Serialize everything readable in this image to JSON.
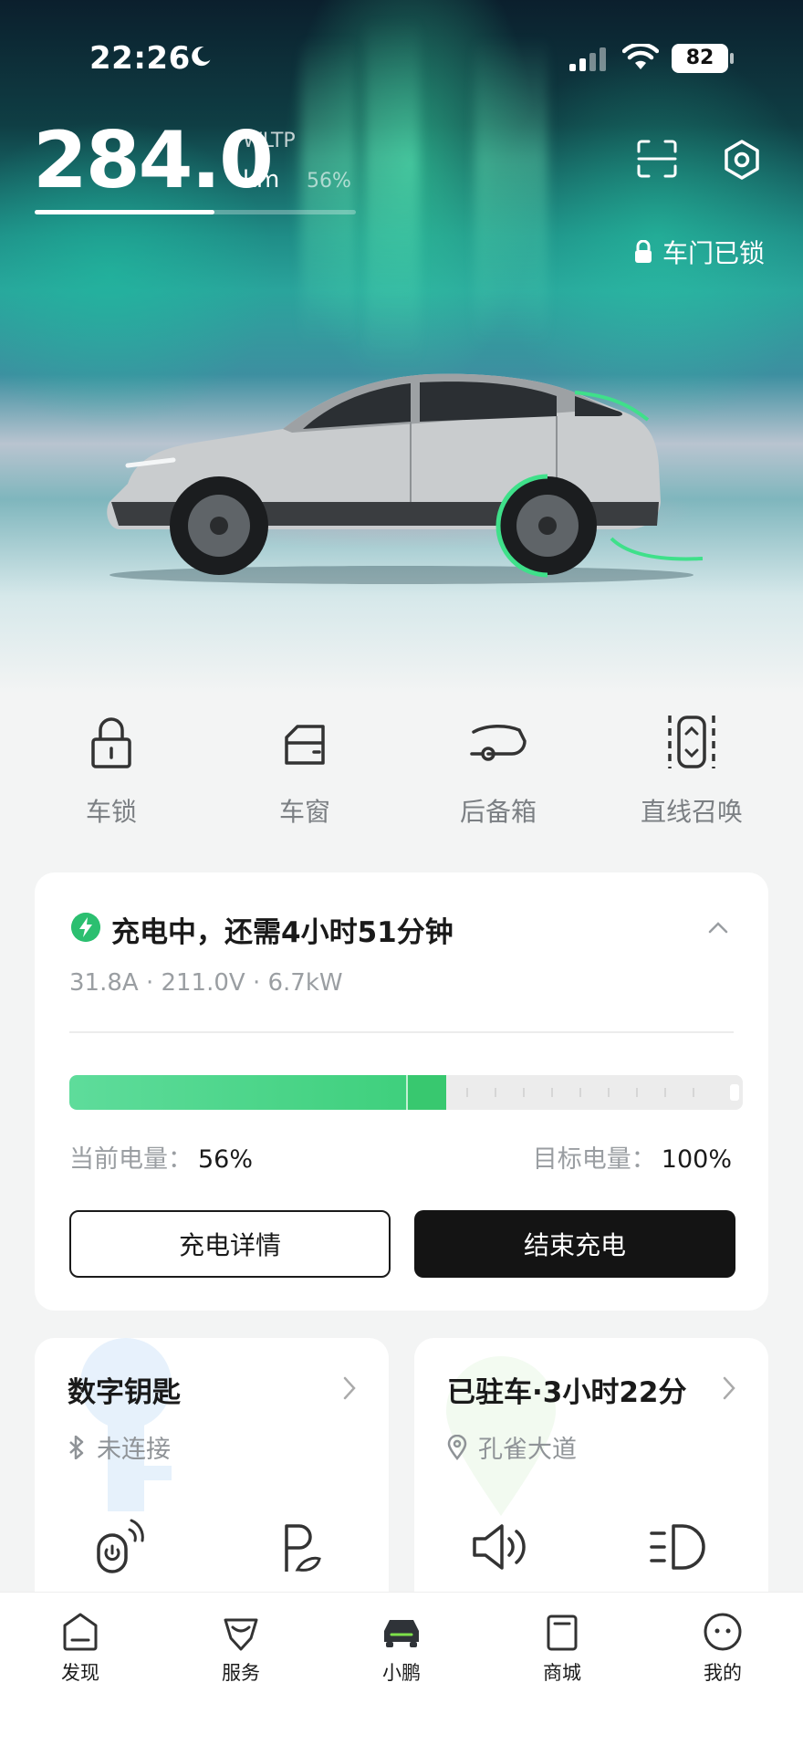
{
  "status_bar": {
    "time": "22:26",
    "battery": "82"
  },
  "vehicle": {
    "range_value": "284.0",
    "range_standard": "WLTP",
    "range_unit": "km",
    "battery_percent_text": "56%",
    "battery_fraction": 0.56,
    "lock_status": "车门已锁"
  },
  "quick_actions": [
    {
      "label": "车锁",
      "icon": "lock-icon"
    },
    {
      "label": "车窗",
      "icon": "window-icon"
    },
    {
      "label": "后备箱",
      "icon": "trunk-icon"
    },
    {
      "label": "直线召唤",
      "icon": "summon-icon"
    }
  ],
  "charging": {
    "title": "充电中，还需4小时51分钟",
    "metrics": "31.8A · 211.0V · 6.7kW",
    "current_label": "当前电量：",
    "current_value": "56%",
    "current_fraction": 0.56,
    "target_label": "目标电量：",
    "target_value": "100%",
    "target_fraction": 1.0,
    "details_button": "充电详情",
    "stop_button": "结束充电",
    "accent_color": "#3fd07d"
  },
  "digital_key": {
    "title": "数字钥匙",
    "status": "未连接"
  },
  "parking": {
    "title": "已驻车·3小时22分",
    "location": "孔雀大道"
  },
  "tabs": [
    {
      "label": "发现",
      "icon": "discover-icon"
    },
    {
      "label": "服务",
      "icon": "service-icon"
    },
    {
      "label": "小鹏",
      "icon": "car-icon"
    },
    {
      "label": "商城",
      "icon": "mall-icon"
    },
    {
      "label": "我的",
      "icon": "profile-icon"
    }
  ]
}
